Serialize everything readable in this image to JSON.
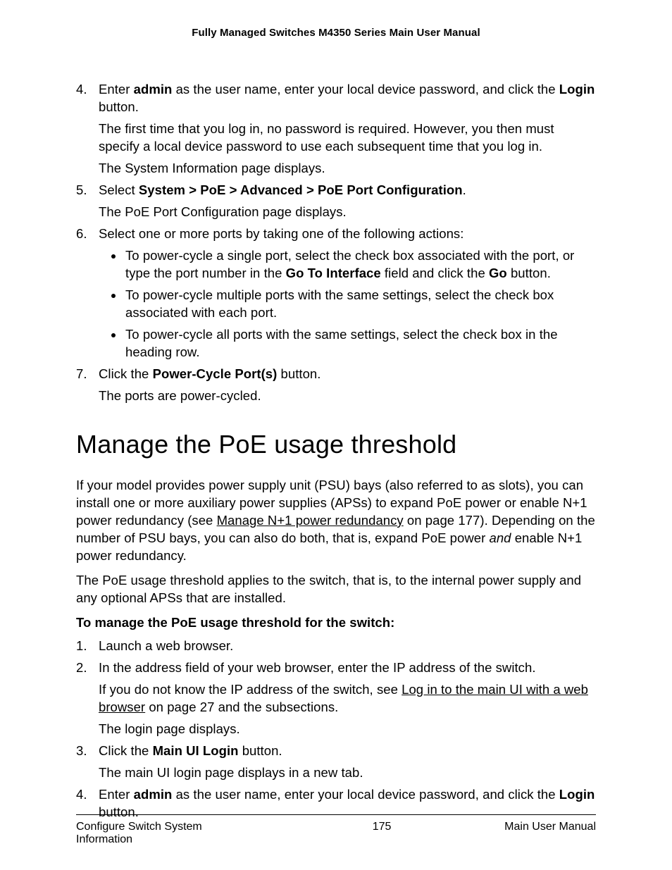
{
  "header": {
    "title": "Fully Managed Switches M4350 Series Main User Manual"
  },
  "content": {
    "step4": {
      "num": "4.",
      "t1": "Enter ",
      "b1": "admin",
      "t2": " as the user name, enter your local device password, and click the ",
      "b2": "Login",
      "t3": " button.",
      "p2": "The first time that you log in, no password is required. However, you then must specify a local device password to use each subsequent time that you log in.",
      "p3": "The System Information page displays."
    },
    "step5": {
      "num": "5.",
      "t1": "Select ",
      "b1": "System > PoE > Advanced > PoE Port Configuration",
      "t2": ".",
      "p2": "The PoE Port Configuration page displays."
    },
    "step6": {
      "num": "6.",
      "p1": "Select one or more ports by taking one of the following actions:",
      "b1a": "To power-cycle a single port, select the check box associated with the port, or type the port number in the ",
      "b1b_bold1": "Go To Interface",
      "b1c": " field and click the ",
      "b1b_bold2": "Go",
      "b1d": " button.",
      "b2": "To power-cycle multiple ports with the same settings, select the check box associated with each port.",
      "b3": "To power-cycle all ports with the same settings, select the check box in the heading row."
    },
    "step7": {
      "num": "7.",
      "t1": "Click the ",
      "b1": "Power-Cycle Port(s)",
      "t2": " button.",
      "p2": "The ports are power-cycled."
    },
    "section_title": "Manage the PoE usage threshold",
    "intro": {
      "p1a": "If your model provides power supply unit (PSU) bays (also referred to as slots), you can install one or more auxiliary power supplies (APSs) to expand PoE power or enable N+1 power redundancy (see ",
      "p1link": "Manage N+1 power redundancy",
      "p1b": " on page 177). Depending on the number of PSU bays, you can also do both, that is, expand PoE power ",
      "p1italic": "and",
      "p1c": " enable N+1 power redundancy.",
      "p2": "The PoE usage threshold applies to the switch, that is, to the internal power supply and any optional APSs that are installed.",
      "p3bold": "To manage the PoE usage threshold for the switch:"
    },
    "steps2": {
      "s1": {
        "num": "1.",
        "p1": "Launch a web browser."
      },
      "s2": {
        "num": "2.",
        "p1": "In the address field of your web browser, enter the IP address of the switch.",
        "p2a": "If you do not know the IP address of the switch, see ",
        "p2link": "Log in to the main UI with a web browser",
        "p2b": " on page 27 and the subsections.",
        "p3": "The login page displays."
      },
      "s3": {
        "num": "3.",
        "t1": "Click the ",
        "b1": "Main UI Login",
        "t2": " button.",
        "p2": "The main UI login page displays in a new tab."
      },
      "s4": {
        "num": "4.",
        "t1": "Enter ",
        "b1": "admin",
        "t2": " as the user name, enter your local device password, and click the ",
        "b2": "Login",
        "t3": " button."
      }
    }
  },
  "footer": {
    "left": "Configure Switch System Information",
    "center": "175",
    "right": "Main User Manual"
  }
}
